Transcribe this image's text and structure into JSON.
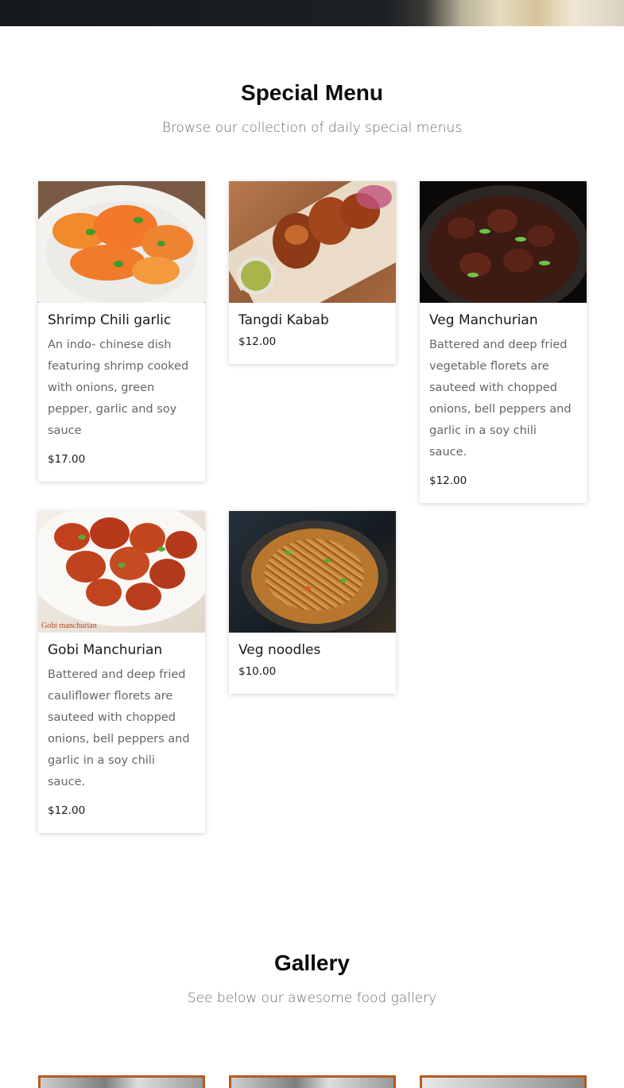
{
  "special_menu": {
    "title": "Special Menu",
    "subtitle": "Browse our collection of daily special menus",
    "items": [
      {
        "name": "Shrimp Chili garlic",
        "description": "An indo- chinese dish featuring shrimp cooked with onions, green pepper, garlic and soy sauce",
        "price": "$17.00",
        "image": "shrimp-dish"
      },
      {
        "name": "Tangdi Kabab",
        "description": "",
        "price": "$12.00",
        "image": "chicken-kabab-dish"
      },
      {
        "name": "Veg Manchurian",
        "description": "Battered and deep fried vegetable florets are sauteed with chopped onions, bell peppers and garlic in a soy chili sauce.",
        "price": "$12.00",
        "image": "veg-manchurian-dish"
      },
      {
        "name": "Gobi Manchurian",
        "description": "Battered and deep fried cauliflower florets are sauteed with chopped onions, bell peppers and garlic in a soy chili sauce.",
        "price": "$12.00",
        "image": "gobi-manchurian-dish",
        "image_caption": "Gobi manchurian"
      },
      {
        "name": "Veg noodles",
        "description": "",
        "price": "$10.00",
        "image": "veg-noodles-dish"
      }
    ]
  },
  "gallery": {
    "title": "Gallery",
    "subtitle": "See below our awesome food gallery",
    "accent_color": "#b75a22"
  }
}
